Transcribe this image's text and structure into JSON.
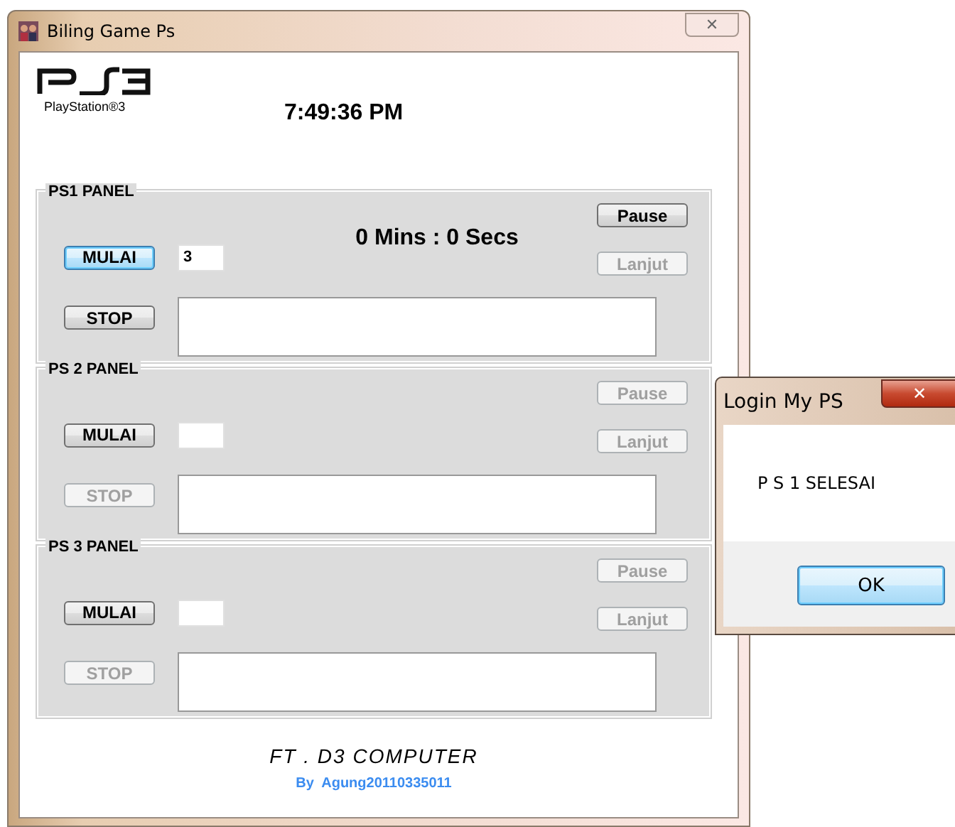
{
  "window": {
    "title": "Biling Game Ps",
    "close": "✕"
  },
  "header": {
    "logo_caption": "PlayStation®3",
    "clock": "7:49:36 PM"
  },
  "panels": [
    {
      "title": "PS1 PANEL",
      "timer": "0 Mins : 0 Secs",
      "input_value": "3",
      "mulai": {
        "label": "MULAI",
        "disabled": false,
        "focused": true
      },
      "stop": {
        "label": "STOP",
        "disabled": false
      },
      "pause": {
        "label": "Pause",
        "disabled": false
      },
      "lanjut": {
        "label": "Lanjut",
        "disabled": true
      }
    },
    {
      "title": "PS 2 PANEL",
      "mulai": {
        "label": "MULAI",
        "disabled": false,
        "focused": false
      },
      "stop": {
        "label": "STOP",
        "disabled": true
      },
      "pause": {
        "label": "Pause",
        "disabled": true
      },
      "lanjut": {
        "label": "Lanjut",
        "disabled": true
      }
    },
    {
      "title": "PS 3 PANEL",
      "mulai": {
        "label": "MULAI",
        "disabled": false,
        "focused": false
      },
      "stop": {
        "label": "STOP",
        "disabled": true
      },
      "pause": {
        "label": "Pause",
        "disabled": true
      },
      "lanjut": {
        "label": "Lanjut",
        "disabled": true
      }
    }
  ],
  "footer": {
    "title": "FT . D3 COMPUTER",
    "credit": "By  Agung20110335011"
  },
  "dialog": {
    "title": "Login My PS",
    "close": "✕",
    "message": "P S 1 SELESAI",
    "button": "OK"
  }
}
